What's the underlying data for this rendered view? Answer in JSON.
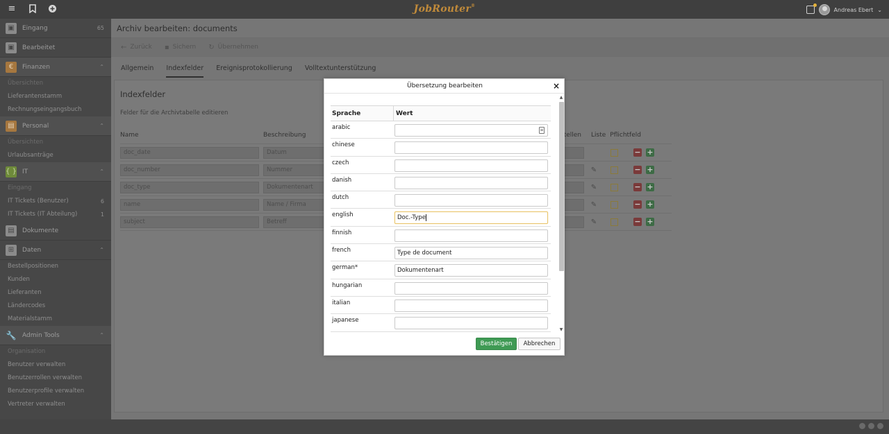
{
  "topbar": {
    "brand": "JobRouter",
    "brand_tm": "®",
    "user_name": "Andreas Ebert"
  },
  "sidebar": {
    "items": [
      {
        "type": "item",
        "label": "Eingang",
        "count": "65",
        "icon": "inbox-icon"
      },
      {
        "type": "item",
        "label": "Bearbeitet",
        "count": "",
        "icon": "inbox-check-icon"
      },
      {
        "type": "section",
        "label": "Finanzen",
        "icon": "euro-icon",
        "variant": ""
      },
      {
        "type": "head",
        "label": "Übersichten"
      },
      {
        "type": "sub",
        "label": "Lieferantenstamm"
      },
      {
        "type": "sub",
        "label": "Rechnungseingangsbuch"
      },
      {
        "type": "section",
        "label": "Personal",
        "icon": "person-icon",
        "variant": ""
      },
      {
        "type": "head",
        "label": "Übersichten"
      },
      {
        "type": "sub",
        "label": "Urlaubsanträge"
      },
      {
        "type": "section",
        "label": "IT",
        "icon": "braces-icon",
        "variant": "it"
      },
      {
        "type": "head",
        "label": "Eingang"
      },
      {
        "type": "sub",
        "label": "IT Tickets (Benutzer)",
        "count": "6"
      },
      {
        "type": "sub",
        "label": "IT Tickets (IT Abteilung)",
        "count": "1"
      },
      {
        "type": "item",
        "label": "Dokumente",
        "count": "",
        "icon": "document-icon"
      },
      {
        "type": "section-plain",
        "label": "Daten",
        "icon": "table-icon"
      },
      {
        "type": "sub",
        "label": "Bestellpositionen"
      },
      {
        "type": "sub",
        "label": "Kunden"
      },
      {
        "type": "sub",
        "label": "Lieferanten"
      },
      {
        "type": "sub",
        "label": "Ländercodes"
      },
      {
        "type": "sub",
        "label": "Materialstamm"
      },
      {
        "type": "section",
        "label": "Admin Tools",
        "icon": "wrench-icon",
        "variant": "admin"
      },
      {
        "type": "head",
        "label": "Organisation"
      },
      {
        "type": "sub",
        "label": "Benutzer verwalten"
      },
      {
        "type": "sub",
        "label": "Benutzerrollen verwalten"
      },
      {
        "type": "sub",
        "label": "Benutzerprofile verwalten"
      },
      {
        "type": "sub",
        "label": "Vertreter verwalten"
      }
    ]
  },
  "main": {
    "title": "Archiv bearbeiten: documents",
    "toolbar": {
      "back": "Zurück",
      "save": "Sichern",
      "apply": "Übernehmen"
    },
    "tabs": [
      {
        "label": "Allgemein",
        "active": false
      },
      {
        "label": "Indexfelder",
        "active": true
      },
      {
        "label": "Ereignisprotokollierung",
        "active": false
      },
      {
        "label": "Volltextunterstützung",
        "active": false
      }
    ],
    "section_title": "Indexfelder",
    "section_desc": "Felder für die Archivtabelle editieren",
    "columns": {
      "name": "Name",
      "description": "Beschreibung",
      "places": "stellen",
      "list": "Liste",
      "required": "Pflichtfeld"
    },
    "rows": [
      {
        "name": "doc_date",
        "description": "Datum"
      },
      {
        "name": "doc_number",
        "description": "Nummer"
      },
      {
        "name": "doc_type",
        "description": "Dokumentenart"
      },
      {
        "name": "name",
        "description": "Name / Firma"
      },
      {
        "name": "subject",
        "description": "Betreff"
      }
    ]
  },
  "modal": {
    "title": "Übersetzung bearbeiten",
    "col_language": "Sprache",
    "col_value": "Wert",
    "rows": [
      {
        "language": "arabic",
        "value": ""
      },
      {
        "language": "chinese",
        "value": ""
      },
      {
        "language": "czech",
        "value": ""
      },
      {
        "language": "danish",
        "value": ""
      },
      {
        "language": "dutch",
        "value": ""
      },
      {
        "language": "english",
        "value": "Doc.-Type"
      },
      {
        "language": "finnish",
        "value": ""
      },
      {
        "language": "french",
        "value": "Type de document"
      },
      {
        "language": "german*",
        "value": "Dokumentenart"
      },
      {
        "language": "hungarian",
        "value": ""
      },
      {
        "language": "italian",
        "value": ""
      },
      {
        "language": "japanese",
        "value": ""
      }
    ],
    "confirm_label": "Bestätigen",
    "cancel_label": "Abbrechen"
  },
  "colors": {
    "confirm": "#3f9a54",
    "brand": "#c08a3a",
    "focus_border": "#e8c46a"
  }
}
